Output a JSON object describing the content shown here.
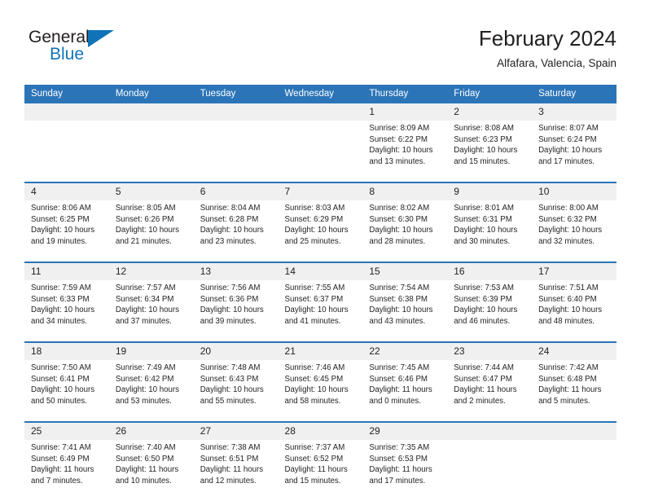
{
  "brand": {
    "name_part1": "General",
    "name_part2": "Blue",
    "logo_icon": "triangle-flag-icon",
    "accent_color": "#1073b8"
  },
  "header": {
    "title": "February 2024",
    "subtitle": "Alfafara, Valencia, Spain"
  },
  "theme": {
    "header_bg": "#2b74b8",
    "daynum_bg": "#f0f0f0",
    "separator": "#2b74b8",
    "text": "#231f20"
  },
  "weekday_headers": [
    "Sunday",
    "Monday",
    "Tuesday",
    "Wednesday",
    "Thursday",
    "Friday",
    "Saturday"
  ],
  "weeks": [
    {
      "days": [
        {
          "num": "",
          "l1": "",
          "l2": "",
          "l3": "",
          "l4": ""
        },
        {
          "num": "",
          "l1": "",
          "l2": "",
          "l3": "",
          "l4": ""
        },
        {
          "num": "",
          "l1": "",
          "l2": "",
          "l3": "",
          "l4": ""
        },
        {
          "num": "",
          "l1": "",
          "l2": "",
          "l3": "",
          "l4": ""
        },
        {
          "num": "1",
          "l1": "Sunrise: 8:09 AM",
          "l2": "Sunset: 6:22 PM",
          "l3": "Daylight: 10 hours",
          "l4": "and 13 minutes."
        },
        {
          "num": "2",
          "l1": "Sunrise: 8:08 AM",
          "l2": "Sunset: 6:23 PM",
          "l3": "Daylight: 10 hours",
          "l4": "and 15 minutes."
        },
        {
          "num": "3",
          "l1": "Sunrise: 8:07 AM",
          "l2": "Sunset: 6:24 PM",
          "l3": "Daylight: 10 hours",
          "l4": "and 17 minutes."
        }
      ]
    },
    {
      "days": [
        {
          "num": "4",
          "l1": "Sunrise: 8:06 AM",
          "l2": "Sunset: 6:25 PM",
          "l3": "Daylight: 10 hours",
          "l4": "and 19 minutes."
        },
        {
          "num": "5",
          "l1": "Sunrise: 8:05 AM",
          "l2": "Sunset: 6:26 PM",
          "l3": "Daylight: 10 hours",
          "l4": "and 21 minutes."
        },
        {
          "num": "6",
          "l1": "Sunrise: 8:04 AM",
          "l2": "Sunset: 6:28 PM",
          "l3": "Daylight: 10 hours",
          "l4": "and 23 minutes."
        },
        {
          "num": "7",
          "l1": "Sunrise: 8:03 AM",
          "l2": "Sunset: 6:29 PM",
          "l3": "Daylight: 10 hours",
          "l4": "and 25 minutes."
        },
        {
          "num": "8",
          "l1": "Sunrise: 8:02 AM",
          "l2": "Sunset: 6:30 PM",
          "l3": "Daylight: 10 hours",
          "l4": "and 28 minutes."
        },
        {
          "num": "9",
          "l1": "Sunrise: 8:01 AM",
          "l2": "Sunset: 6:31 PM",
          "l3": "Daylight: 10 hours",
          "l4": "and 30 minutes."
        },
        {
          "num": "10",
          "l1": "Sunrise: 8:00 AM",
          "l2": "Sunset: 6:32 PM",
          "l3": "Daylight: 10 hours",
          "l4": "and 32 minutes."
        }
      ]
    },
    {
      "days": [
        {
          "num": "11",
          "l1": "Sunrise: 7:59 AM",
          "l2": "Sunset: 6:33 PM",
          "l3": "Daylight: 10 hours",
          "l4": "and 34 minutes."
        },
        {
          "num": "12",
          "l1": "Sunrise: 7:57 AM",
          "l2": "Sunset: 6:34 PM",
          "l3": "Daylight: 10 hours",
          "l4": "and 37 minutes."
        },
        {
          "num": "13",
          "l1": "Sunrise: 7:56 AM",
          "l2": "Sunset: 6:36 PM",
          "l3": "Daylight: 10 hours",
          "l4": "and 39 minutes."
        },
        {
          "num": "14",
          "l1": "Sunrise: 7:55 AM",
          "l2": "Sunset: 6:37 PM",
          "l3": "Daylight: 10 hours",
          "l4": "and 41 minutes."
        },
        {
          "num": "15",
          "l1": "Sunrise: 7:54 AM",
          "l2": "Sunset: 6:38 PM",
          "l3": "Daylight: 10 hours",
          "l4": "and 43 minutes."
        },
        {
          "num": "16",
          "l1": "Sunrise: 7:53 AM",
          "l2": "Sunset: 6:39 PM",
          "l3": "Daylight: 10 hours",
          "l4": "and 46 minutes."
        },
        {
          "num": "17",
          "l1": "Sunrise: 7:51 AM",
          "l2": "Sunset: 6:40 PM",
          "l3": "Daylight: 10 hours",
          "l4": "and 48 minutes."
        }
      ]
    },
    {
      "days": [
        {
          "num": "18",
          "l1": "Sunrise: 7:50 AM",
          "l2": "Sunset: 6:41 PM",
          "l3": "Daylight: 10 hours",
          "l4": "and 50 minutes."
        },
        {
          "num": "19",
          "l1": "Sunrise: 7:49 AM",
          "l2": "Sunset: 6:42 PM",
          "l3": "Daylight: 10 hours",
          "l4": "and 53 minutes."
        },
        {
          "num": "20",
          "l1": "Sunrise: 7:48 AM",
          "l2": "Sunset: 6:43 PM",
          "l3": "Daylight: 10 hours",
          "l4": "and 55 minutes."
        },
        {
          "num": "21",
          "l1": "Sunrise: 7:46 AM",
          "l2": "Sunset: 6:45 PM",
          "l3": "Daylight: 10 hours",
          "l4": "and 58 minutes."
        },
        {
          "num": "22",
          "l1": "Sunrise: 7:45 AM",
          "l2": "Sunset: 6:46 PM",
          "l3": "Daylight: 11 hours",
          "l4": "and 0 minutes."
        },
        {
          "num": "23",
          "l1": "Sunrise: 7:44 AM",
          "l2": "Sunset: 6:47 PM",
          "l3": "Daylight: 11 hours",
          "l4": "and 2 minutes."
        },
        {
          "num": "24",
          "l1": "Sunrise: 7:42 AM",
          "l2": "Sunset: 6:48 PM",
          "l3": "Daylight: 11 hours",
          "l4": "and 5 minutes."
        }
      ]
    },
    {
      "days": [
        {
          "num": "25",
          "l1": "Sunrise: 7:41 AM",
          "l2": "Sunset: 6:49 PM",
          "l3": "Daylight: 11 hours",
          "l4": "and 7 minutes."
        },
        {
          "num": "26",
          "l1": "Sunrise: 7:40 AM",
          "l2": "Sunset: 6:50 PM",
          "l3": "Daylight: 11 hours",
          "l4": "and 10 minutes."
        },
        {
          "num": "27",
          "l1": "Sunrise: 7:38 AM",
          "l2": "Sunset: 6:51 PM",
          "l3": "Daylight: 11 hours",
          "l4": "and 12 minutes."
        },
        {
          "num": "28",
          "l1": "Sunrise: 7:37 AM",
          "l2": "Sunset: 6:52 PM",
          "l3": "Daylight: 11 hours",
          "l4": "and 15 minutes."
        },
        {
          "num": "29",
          "l1": "Sunrise: 7:35 AM",
          "l2": "Sunset: 6:53 PM",
          "l3": "Daylight: 11 hours",
          "l4": "and 17 minutes."
        },
        {
          "num": "",
          "l1": "",
          "l2": "",
          "l3": "",
          "l4": ""
        },
        {
          "num": "",
          "l1": "",
          "l2": "",
          "l3": "",
          "l4": ""
        }
      ]
    }
  ]
}
